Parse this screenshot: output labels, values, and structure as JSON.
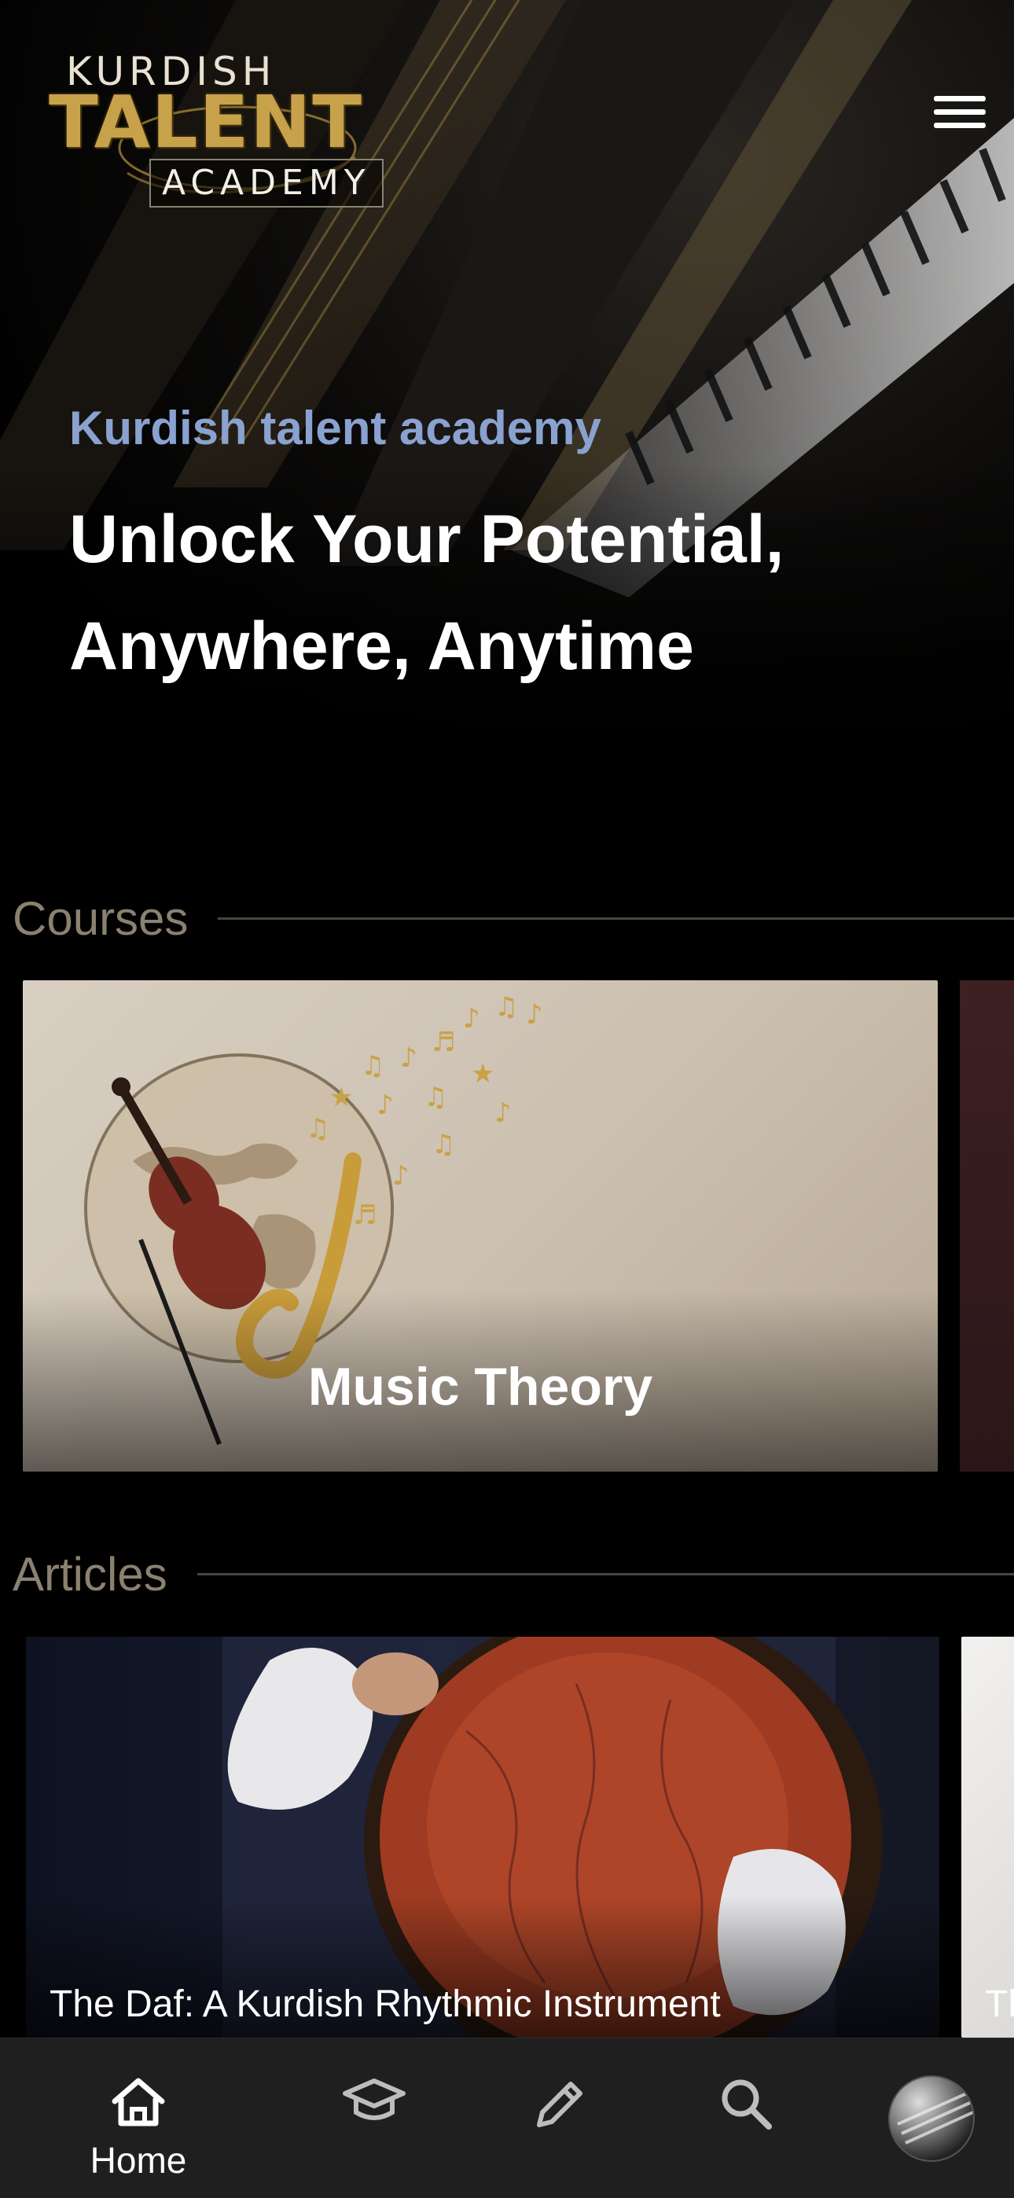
{
  "brand": {
    "line1": "KURDISH",
    "line2": "TALENT",
    "line3": "ACADEMY"
  },
  "hero": {
    "subtitle": "Kurdish talent academy",
    "title": "Unlock Your Potential, Anywhere, Anytime"
  },
  "sections": {
    "courses": {
      "label": "Courses",
      "items": [
        {
          "title": "Music Theory"
        }
      ]
    },
    "articles": {
      "label": "Articles",
      "items": [
        {
          "title": "The Daf: A Kurdish Rhythmic Instrument"
        },
        {
          "title": "Th"
        }
      ]
    }
  },
  "bottom_nav": {
    "items": [
      {
        "label": "Home",
        "icon": "home-icon",
        "active": true
      },
      {
        "label": "",
        "icon": "graduation-cap-icon",
        "active": false
      },
      {
        "label": "",
        "icon": "pencil-icon",
        "active": false
      },
      {
        "label": "",
        "icon": "search-icon",
        "active": false
      },
      {
        "label": "",
        "icon": "profile-avatar",
        "active": false
      }
    ]
  },
  "colors": {
    "accent_blue": "#8aa2cf",
    "section_label": "#8b8170",
    "logo_gold": "#c8a24a",
    "nav_background": "#1f1f1f"
  }
}
